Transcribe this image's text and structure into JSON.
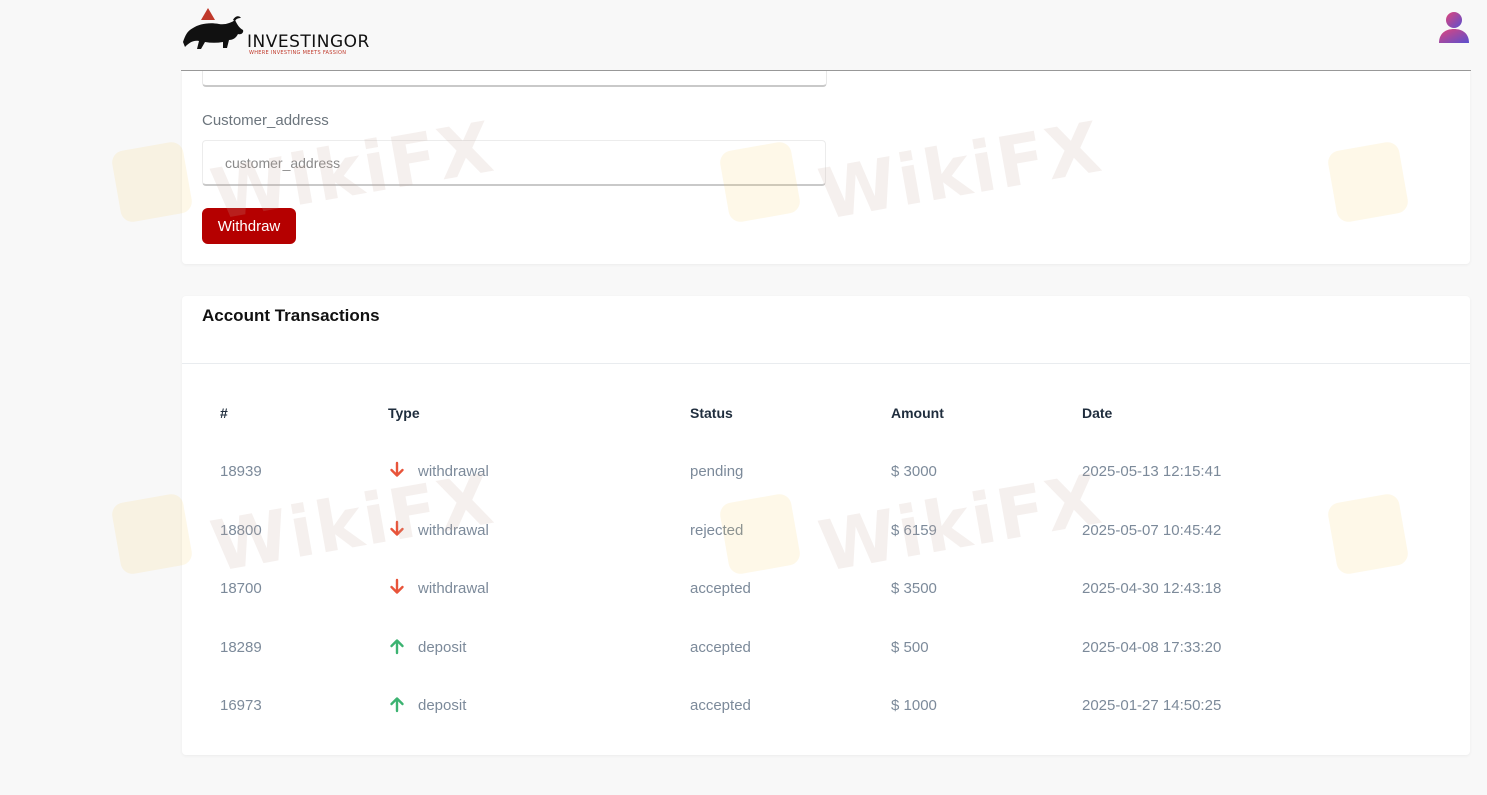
{
  "header": {
    "brand_name": "INVESTINGOR",
    "brand_tagline": "WHERE INVESTING MEETS FASSION",
    "user_icon": "user-avatar-icon"
  },
  "withdraw_form": {
    "address_label": "Customer_address",
    "address_placeholder": "customer_address",
    "submit_label": "Withdraw"
  },
  "transactions": {
    "title": "Account Transactions",
    "columns": [
      "#",
      "Type",
      "Status",
      "Amount",
      "Date"
    ],
    "rows": [
      {
        "id": "18939",
        "type": "withdrawal",
        "direction": "down",
        "status": "pending",
        "amount": "$ 3000",
        "date": "2025-05-13 12:15:41"
      },
      {
        "id": "18800",
        "type": "withdrawal",
        "direction": "down",
        "status": "rejected",
        "amount": "$ 6159",
        "date": "2025-05-07 10:45:42"
      },
      {
        "id": "18700",
        "type": "withdrawal",
        "direction": "down",
        "status": "accepted",
        "amount": "$ 3500",
        "date": "2025-04-30 12:43:18"
      },
      {
        "id": "18289",
        "type": "deposit",
        "direction": "up",
        "status": "accepted",
        "amount": "$ 500",
        "date": "2025-04-08 17:33:20"
      },
      {
        "id": "16973",
        "type": "deposit",
        "direction": "up",
        "status": "accepted",
        "amount": "$ 1000",
        "date": "2025-01-27 14:50:25"
      }
    ]
  },
  "colors": {
    "primary_button": "#b50000",
    "arrow_down": "#e8543a",
    "arrow_up": "#3cb371"
  },
  "watermark": {
    "text": "WikiFX"
  }
}
